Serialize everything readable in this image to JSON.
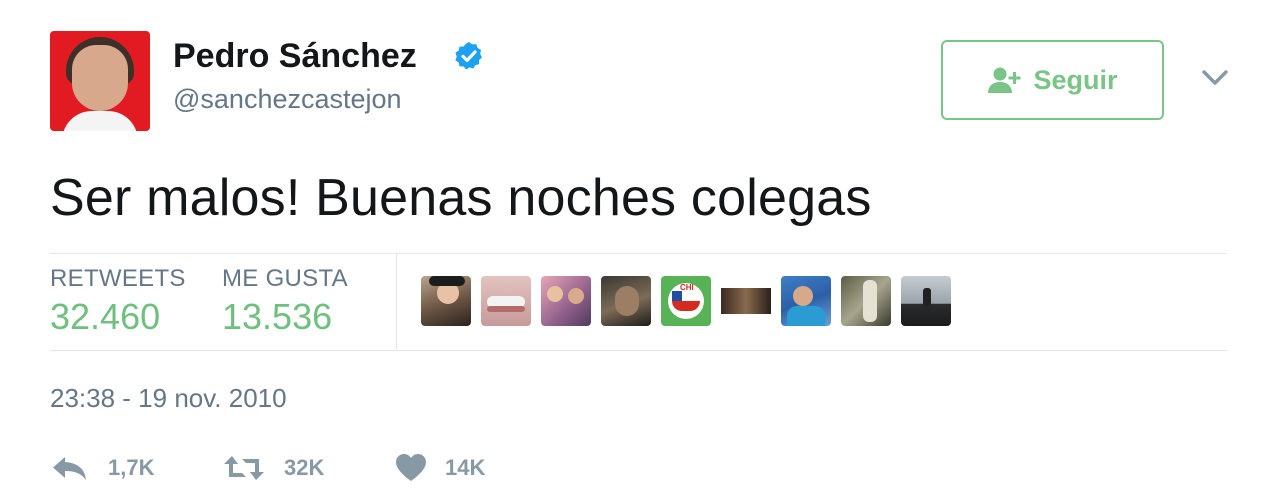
{
  "user": {
    "name": "Pedro Sánchez",
    "handle": "@sanchezcastejon",
    "verified": true
  },
  "follow_button": {
    "label": "Seguir"
  },
  "tweet": {
    "text": "Ser malos! Buenas noches colegas",
    "timestamp": "23:38 - 19 nov. 2010"
  },
  "stats": {
    "retweets_label": "RETWEETS",
    "retweets_value": "32.460",
    "likes_label": "ME GUSTA",
    "likes_value": "13.536"
  },
  "likers": [
    {
      "name": "liker-1"
    },
    {
      "name": "liker-2"
    },
    {
      "name": "liker-3"
    },
    {
      "name": "liker-4"
    },
    {
      "name": "liker-5"
    },
    {
      "name": "liker-6"
    },
    {
      "name": "liker-7"
    },
    {
      "name": "liker-8"
    },
    {
      "name": "liker-9"
    }
  ],
  "actions": {
    "reply_count": "1,7K",
    "retweet_count": "32K",
    "like_count": "14K"
  },
  "colors": {
    "accent_green": "#79c486",
    "verified_blue": "#1da1f2",
    "muted_text": "#657786"
  }
}
